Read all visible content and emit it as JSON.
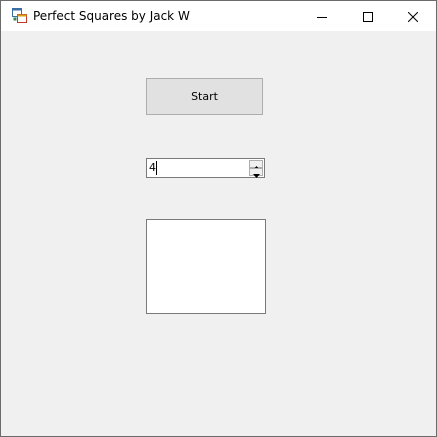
{
  "window": {
    "title": "Perfect Squares by Jack W",
    "app_icon": "winforms-app-icon"
  },
  "caption_buttons": {
    "minimize_icon": "minimize-icon",
    "maximize_icon": "maximize-icon",
    "close_icon": "close-icon"
  },
  "form": {
    "start_button_label": "Start",
    "number_value": "4",
    "output_text": ""
  },
  "colors": {
    "form_background": "#f0f0f0",
    "button_face": "#e1e1e1",
    "border": "#7a7a7a"
  }
}
